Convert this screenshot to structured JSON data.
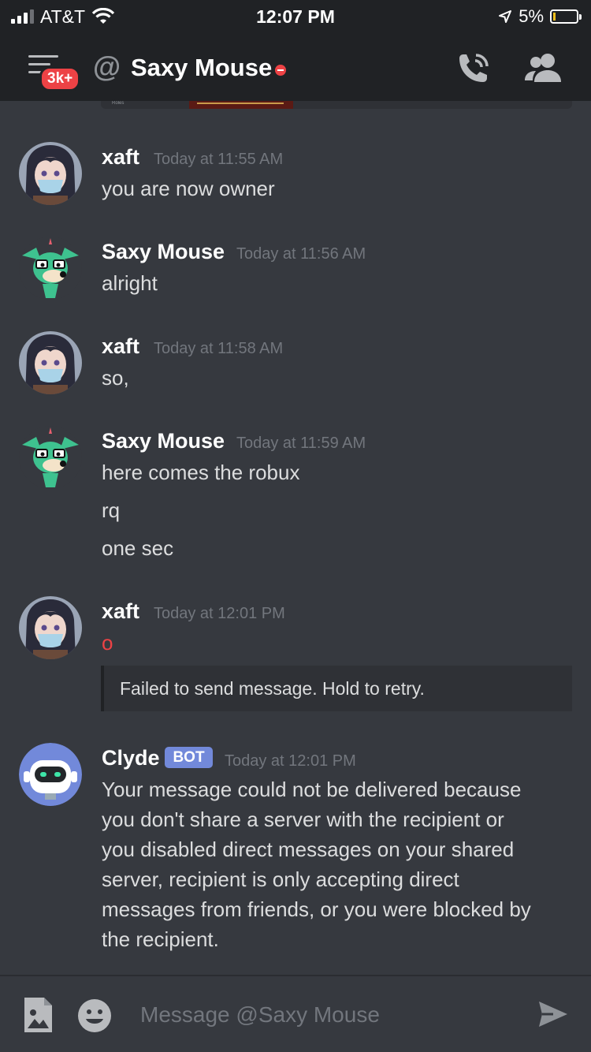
{
  "status_bar": {
    "carrier": "AT&T",
    "time": "12:07 PM",
    "battery": "5%"
  },
  "header": {
    "badge": "3k+",
    "at_symbol": "@",
    "title": "Saxy Mouse"
  },
  "embed_peek": {
    "roles_label": "Roles"
  },
  "messages": [
    {
      "author": "xaft",
      "timestamp": "Today at 11:55 AM",
      "lines": [
        "you are now owner"
      ]
    },
    {
      "author": "Saxy Mouse",
      "timestamp": "Today at 11:56 AM",
      "lines": [
        "alright"
      ]
    },
    {
      "author": "xaft",
      "timestamp": "Today at 11:58 AM",
      "lines": [
        "so,"
      ]
    },
    {
      "author": "Saxy Mouse",
      "timestamp": "Today at 11:59 AM",
      "lines": [
        "here comes the robux",
        "rq",
        "one sec"
      ]
    },
    {
      "author": "xaft",
      "timestamp": "Today at 12:01 PM",
      "lines": [
        "o"
      ],
      "failed_notice": "Failed to send message. Hold to retry."
    },
    {
      "author": "Clyde",
      "tag": "BOT",
      "timestamp": "Today at 12:01 PM",
      "lines": [
        "Your message could not be delivered because",
        "you don't share a server with the recipient or",
        "you disabled direct messages on your shared",
        "server, recipient is only accepting direct",
        "messages from friends, or you were blocked by",
        "the recipient."
      ]
    }
  ],
  "composer": {
    "placeholder": "Message @Saxy Mouse"
  },
  "colors": {
    "background": "#36393f",
    "header": "#202225",
    "failed_text": "#ed4245",
    "bot_tag": "#7289da",
    "dnd": "#ed4245"
  }
}
